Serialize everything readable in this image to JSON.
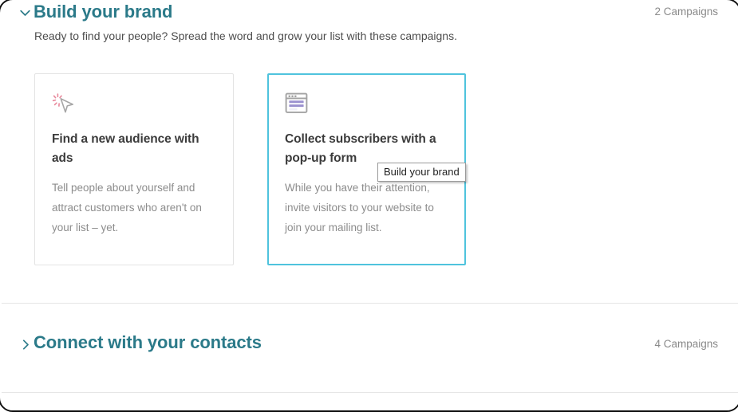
{
  "theme": {
    "heading_color": "#2b7a89",
    "selected_card_border": "#4fc3dd",
    "card_border": "#e3e3e3",
    "muted_text": "#8c8c8c",
    "title_text": "#3b3b3b",
    "divider": "#e6e6e6"
  },
  "sections": [
    {
      "title": "Build your brand",
      "count_label": "2 Campaigns",
      "subtitle": "Ready to find your people? Spread the word and grow your list with these campaigns.",
      "expanded": true,
      "toggle_icon": "chevron-down-icon",
      "cards": [
        {
          "icon": "cursor-click-icon",
          "title": "Find a new audience with ads",
          "description": "Tell people about yourself and attract customers who aren't on your list – yet.",
          "selected": false
        },
        {
          "icon": "popup-form-icon",
          "title": "Collect subscribers with a pop-up form",
          "description": "While you have their attention, invite visitors to your website to join your mailing list.",
          "selected": true
        }
      ]
    },
    {
      "title": "Connect with your contacts",
      "count_label": "4 Campaigns",
      "expanded": false,
      "toggle_icon": "chevron-right-icon"
    }
  ],
  "tooltip": {
    "text": "Build your brand"
  }
}
